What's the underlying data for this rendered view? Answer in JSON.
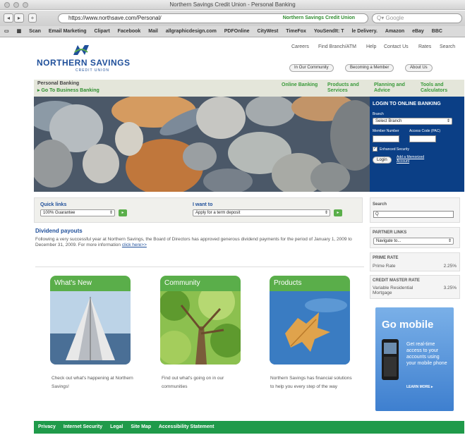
{
  "browser": {
    "window_title": "Northern Savings Credit Union - Personal Banking",
    "url": "https://www.northsave.com/Personal/",
    "site_identity": "Northern Savings Credit Union",
    "search_placeholder": "Google",
    "bookmarks": [
      "Scan",
      "Email Marketing",
      "Clipart",
      "Facebook",
      "Mail",
      "allgraphicdesign.com",
      "PDFOnline",
      "CityWest",
      "TimeFox",
      "YouSendIt: T",
      "le Delivery.",
      "Amazon",
      "eBay",
      "BBC"
    ]
  },
  "logo": {
    "name": "NORTHERN SAVINGS",
    "sub": "CREDIT UNION"
  },
  "topnav": [
    "Careers",
    "Find Branch/ATM",
    "Help",
    "Contact Us",
    "Rates",
    "Search"
  ],
  "pills": [
    "In Our Community",
    "Becoming a Member",
    "About Us"
  ],
  "section": {
    "title": "Personal Banking",
    "link": "▸ Go To Business Banking"
  },
  "greennav": [
    "Online Banking",
    "Products and Services",
    "Planning and Advice",
    "Tools and Calculators"
  ],
  "login": {
    "title": "LOGIN TO ONLINE BANKING",
    "branch_label": "Branch",
    "branch_value": "Select Branch",
    "member_label": "Member Number",
    "pac_label": "Access Code (PAC)",
    "enhanced": "Enhanced Security",
    "login_btn": "Login",
    "memorized": "Add a Memorized Account"
  },
  "quicklinks": {
    "title": "Quick links",
    "value": "100% Guarantee"
  },
  "iwant": {
    "title": "I want to",
    "value": "Apply for a term deposit"
  },
  "dividend": {
    "title": "Dividend payouts",
    "text": "Following a very successful year at Northern Savings, the Board of Directors has approved generous dividend payments for the period of January 1, 2009 to December 31, 2009.  For more information ",
    "link": "click here>>"
  },
  "sidebar": {
    "search_title": "Search",
    "partner_title": "PARTNER LINKS",
    "partner_value": "Navigate to...",
    "prime_title": "PRIME RATE",
    "prime_label": "Prime Rate",
    "prime_value": "2.25%",
    "credit_title": "CREDIT MASTER RATE",
    "credit_label": "Variable Residential Mortgage",
    "credit_value": "3.25%",
    "gomobile_title": "Go mobile",
    "gomobile_text": "Get real-time access to your accounts using your mobile phone",
    "gomobile_more": "LEARN MORE ▸"
  },
  "cards": [
    {
      "title": "What's New",
      "text": "Check out what's happening at Northern Savings!"
    },
    {
      "title": "Community",
      "text": "Find out what's going on in our communities"
    },
    {
      "title": "Products",
      "text": "Northern Savings has financial solutions to help you every step of the way"
    }
  ],
  "footer": [
    "Privacy",
    "Internet Security",
    "Legal",
    "Site Map",
    "Accessibility Statement"
  ],
  "colors": {
    "brand_blue": "#1f4f9a",
    "brand_green": "#5aae4a",
    "footer_green": "#1f9a4a",
    "login_blue": "#0b3f86"
  }
}
